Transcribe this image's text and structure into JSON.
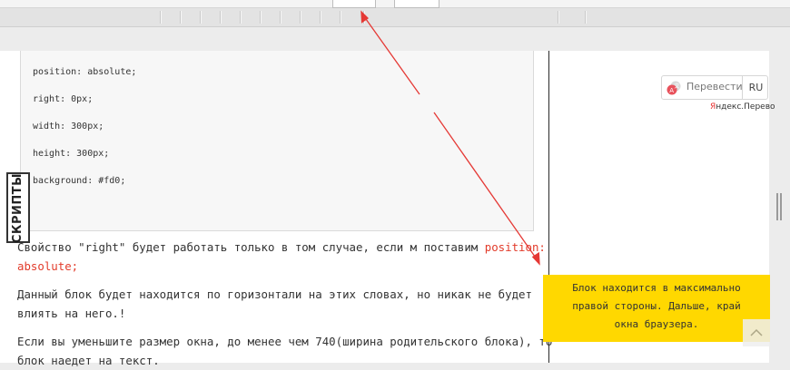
{
  "code": {
    "lines": [
      "position: absolute;",
      "right: 0px;",
      "width: 300px;",
      "height: 300px;",
      "background: #fd0;"
    ]
  },
  "side_tab": {
    "label": "СКРИПТЫ"
  },
  "article": {
    "p1_text": "Свойство \"right\" будет работать только в том случае, если м поставим",
    "p1_code_a": "position:",
    "p1_code_b": "absolute;",
    "p2_line1": "Данный блок будет находится по горизонтали на этих словах, но никак не будет",
    "p2_line2": "влиять на него.!",
    "p3_line1": "Если вы уменьшите размер окна, до менее чем 740(ширина родительского блока), то",
    "p3_line2": "блок наедет на текст."
  },
  "translate": {
    "button_label": "Перевести",
    "lang": "RU",
    "provider_prefix": "Я",
    "provider_rest": "ндекс.Перево"
  },
  "yellow_block": {
    "line1": "Блок находится в максимально",
    "line2": "правой стороны. Дальше, край",
    "line3": "окна браузера."
  },
  "colors": {
    "accent_red": "#e23b2a",
    "block_yellow": "#ffd800",
    "arrow": "#e53935"
  },
  "icons": [
    "translate-icon",
    "chevron-up-icon",
    "scroll-grip-icon"
  ]
}
